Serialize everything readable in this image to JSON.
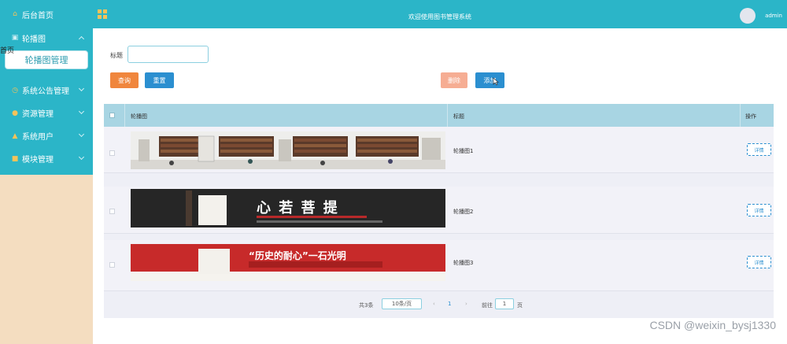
{
  "sidebar": {
    "home": "后台首页",
    "carousel_group": "轮播图",
    "carousel_manage": "轮播图管理",
    "stray_label": "首页",
    "items": [
      {
        "label": "系统公告管理",
        "icon": "clock-icon"
      },
      {
        "label": "资源管理",
        "icon": "pin-icon"
      },
      {
        "label": "系统用户",
        "icon": "user-icon"
      },
      {
        "label": "模块管理",
        "icon": "grid-icon"
      }
    ]
  },
  "header": {
    "title": "欢迎使用图书管理系统",
    "username": "admin"
  },
  "search": {
    "title_label": "标题",
    "title_value": ""
  },
  "buttons": {
    "query": "查询",
    "reset": "重置",
    "delete": "删除",
    "add": "添加"
  },
  "table": {
    "columns": {
      "image": "轮播图",
      "title": "标题",
      "actions": "操作"
    },
    "rows": [
      {
        "title": "轮播图1",
        "action": "详情"
      },
      {
        "title": "轮播图2",
        "action": "详情",
        "banner_text": "心 若 菩 提"
      },
      {
        "title": "轮播图3",
        "action": "详情",
        "banner_text": "“历史的耐心”一石光明"
      }
    ]
  },
  "pagination": {
    "total": "共3条",
    "page_size": "10条/页",
    "current_page": "1",
    "goto_label": "前往",
    "goto_value": "1",
    "page_unit": "页"
  },
  "watermark": "CSDN @weixin_bysj1330",
  "colors": {
    "primary": "#2bb5c8",
    "query": "#f0863d",
    "blue": "#2b8fd0",
    "delete": "#f6ad93",
    "sidebar_bg": "#f4ddc0",
    "table_header": "#a8d5e3"
  }
}
